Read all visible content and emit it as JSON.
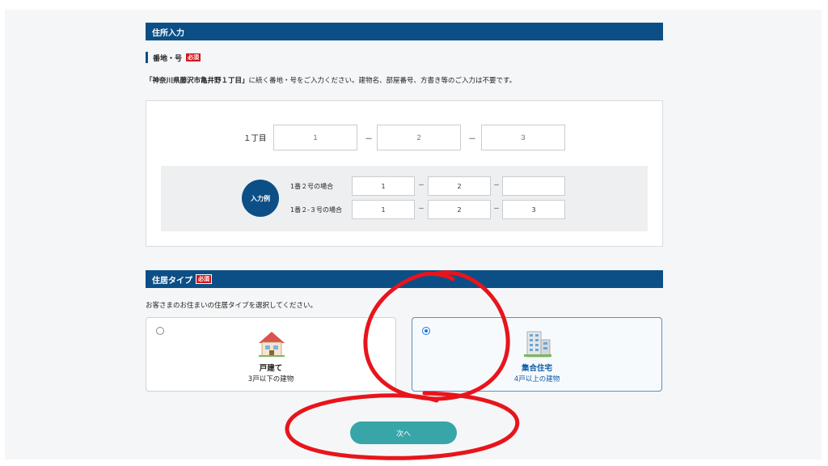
{
  "address_section": {
    "header": "住所入力",
    "field_label": "番地・号",
    "required_badge": "必須",
    "instruction_bold": "「神奈川県藤沢市亀井野１丁目」",
    "instruction_rest": "に続く番地・号をご入力ください。建物名、部屋番号、方書き等のご入力は不要です。",
    "chome_label": "１丁目",
    "inputs": [
      {
        "placeholder": "1",
        "value": ""
      },
      {
        "placeholder": "2",
        "value": ""
      },
      {
        "placeholder": "3",
        "value": ""
      }
    ],
    "dash": "－",
    "example": {
      "badge": "入力例",
      "rows": [
        {
          "label": "1番２号の場合",
          "values": [
            "1",
            "2",
            ""
          ]
        },
        {
          "label": "1番２-３号の場合",
          "values": [
            "1",
            "2",
            "3"
          ]
        }
      ]
    }
  },
  "residence_section": {
    "header": "住居タイプ",
    "required_badge": "必須",
    "instruction": "お客さまのお住まいの住居タイプを選択してください。",
    "options": [
      {
        "title": "戸建て",
        "desc": "3戸以下の建物",
        "selected": false,
        "icon": "house-icon"
      },
      {
        "title": "集合住宅",
        "desc": "4戸以上の建物",
        "selected": true,
        "icon": "apartment-building-icon",
        "color": "#0b5aa6"
      }
    ]
  },
  "next_button": "次へ",
  "colors": {
    "header": "#0b4f86",
    "required": "#d3141c",
    "button": "#38a5a8",
    "annotation": "#e8141c"
  }
}
